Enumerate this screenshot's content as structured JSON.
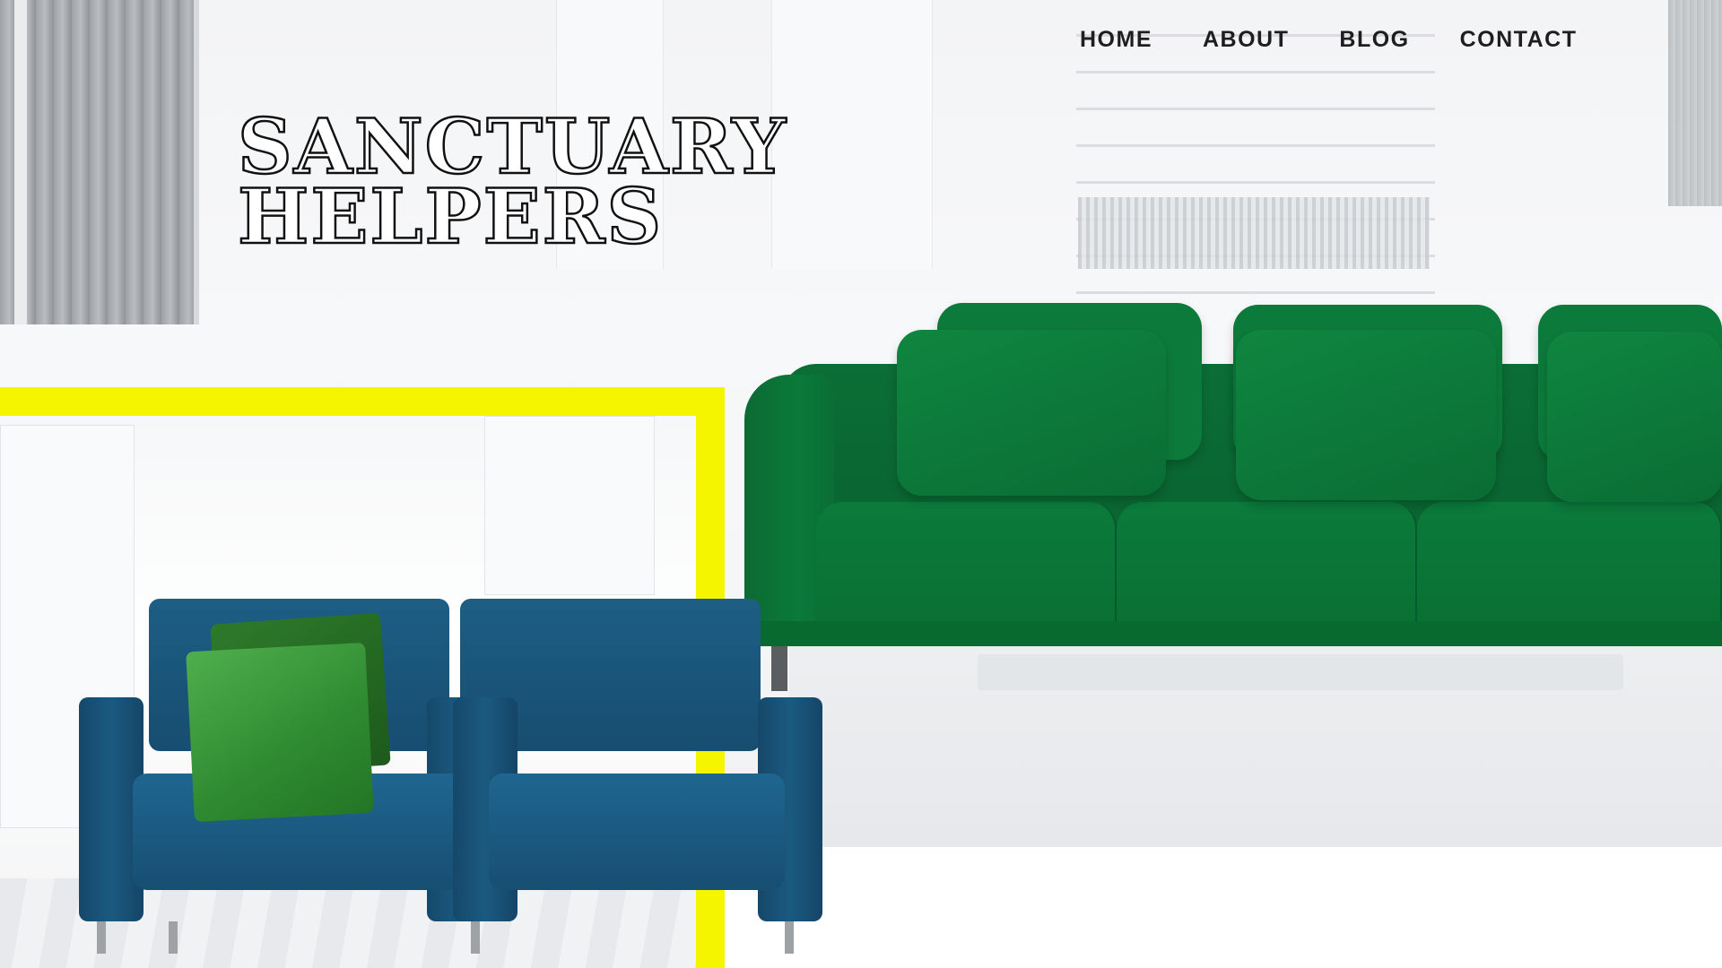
{
  "site": {
    "logo_line1": "SANCTUARY",
    "logo_line2": "HELPERS"
  },
  "nav": {
    "items": [
      {
        "label": "HOME"
      },
      {
        "label": "ABOUT"
      },
      {
        "label": "BLOG"
      },
      {
        "label": "CONTACT"
      }
    ]
  },
  "colors": {
    "accent_yellow": "#f5f500",
    "sofa_green": "#0b7a3b",
    "chair_blue": "#1d5e85",
    "nav_text": "#1e1e1e"
  },
  "icons": {
    "hero_image": "living-room-furniture-image"
  }
}
